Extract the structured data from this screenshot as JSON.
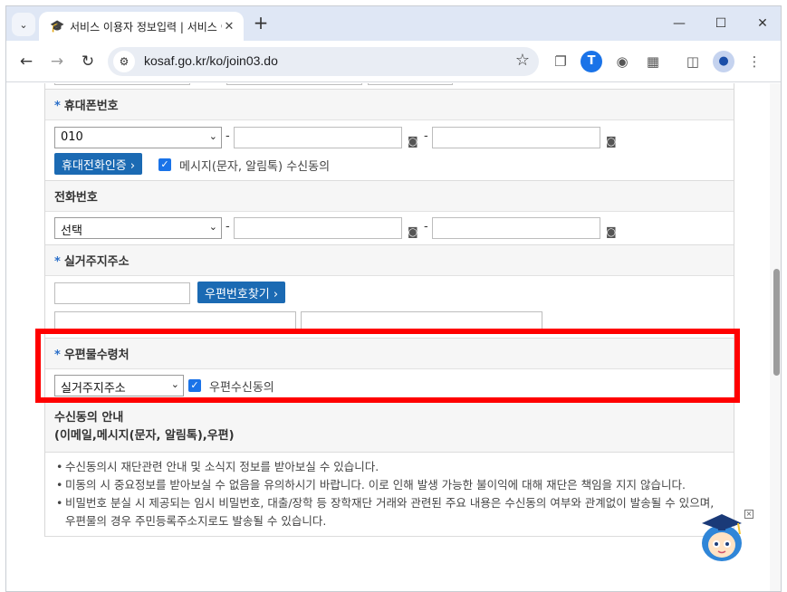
{
  "browser": {
    "tab_title": "서비스 이용자 정보입력 | 서비스 이용",
    "url": "kosaf.go.kr/ko/join03.do",
    "colors": {
      "tabbar": "#dfe7f5",
      "accent": "#1a73e8"
    }
  },
  "form": {
    "mobile": {
      "label": "휴대폰번호",
      "prefix_value": "010",
      "verify_button": "휴대전화인증",
      "consent_label": "메시지(문자, 알림톡) 수신동의",
      "consent_checked": true
    },
    "phone": {
      "label": "전화번호",
      "prefix_value": "선택"
    },
    "address": {
      "label": "실거주지주소",
      "zip_button": "우편번호찾기"
    },
    "mail_recipient": {
      "label": "우편물수령처",
      "select_value": "실거주지주소",
      "consent_label": "우편수신동의",
      "consent_checked": true
    },
    "separator": "-",
    "required_mark": "*"
  },
  "notice": {
    "title_line1": "수신동의 안내",
    "title_line2": "(이메일,메시지(문자, 알림톡),우편)",
    "items": [
      "수신동의시 재단관련 안내 및 소식지 정보를 받아보실 수 있습니다.",
      "미동의 시 중요정보를 받아보실 수 없음을 유의하시기 바랍니다. 이로 인해 발생 가능한 불이익에 대해 재단은 책임을 지지 않습니다.",
      "비밀번호 분실 시 제공되는 임시 비밀번호, 대출/장학 등 장학재단 거래와 관련된 주요 내용은 수신동의 여부와 관계없이 발송될 수 있으며, 우편물의 경우 주민등록주소지로도 발송될 수 있습니다."
    ]
  },
  "highlight": {
    "color": "#ff0000"
  }
}
